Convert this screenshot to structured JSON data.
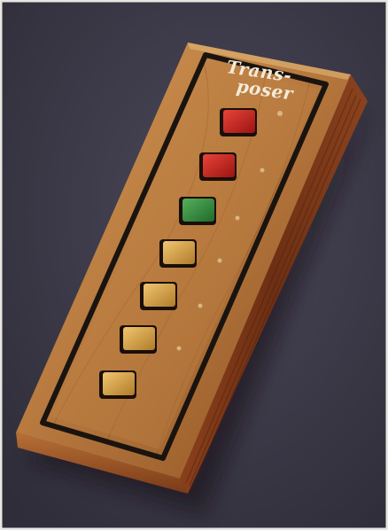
{
  "device": {
    "brand": {
      "line1": "Trans-",
      "line2": "poser"
    },
    "buttons": [
      {
        "name": "button-1",
        "color": "red"
      },
      {
        "name": "button-2",
        "color": "red"
      },
      {
        "name": "button-3",
        "color": "green"
      },
      {
        "name": "button-4",
        "color": "amber"
      },
      {
        "name": "button-5",
        "color": "amber"
      },
      {
        "name": "button-6",
        "color": "amber"
      },
      {
        "name": "button-7",
        "color": "amber"
      }
    ]
  },
  "colors": {
    "background": "#3f3d4c",
    "wood_light": "#b7763c",
    "wood_dark": "#6e3317",
    "inlay": "#1a1410",
    "red": "#c21e1a",
    "green": "#2f8a3a",
    "amber": "#d9a246"
  }
}
